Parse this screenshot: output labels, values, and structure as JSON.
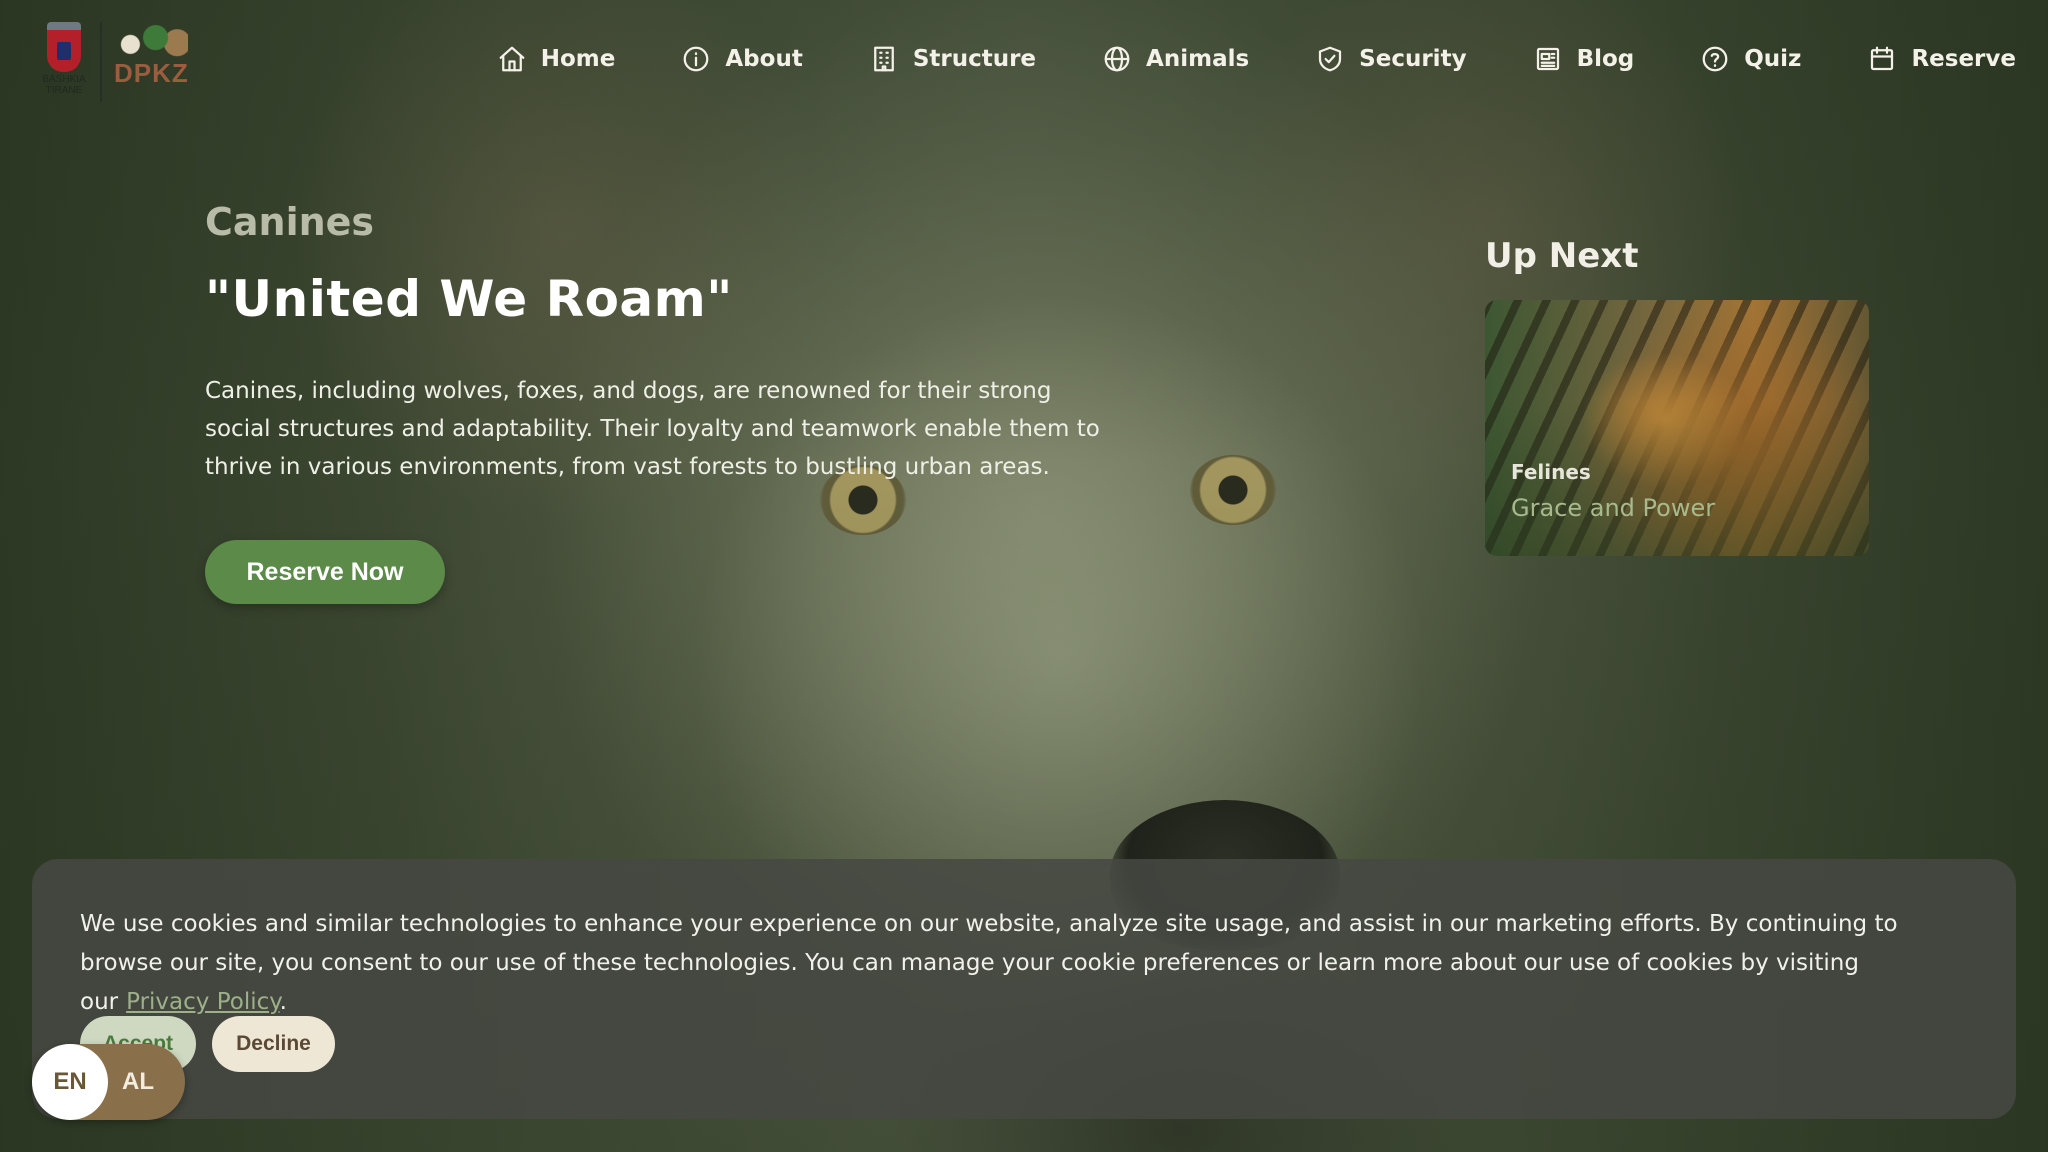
{
  "logo": {
    "city_name": "BASHKIA TIRANE",
    "org_name": "DPKZ"
  },
  "nav": {
    "items": [
      {
        "label": "Home",
        "icon": "home-icon"
      },
      {
        "label": "About",
        "icon": "info-icon"
      },
      {
        "label": "Structure",
        "icon": "building-icon"
      },
      {
        "label": "Animals",
        "icon": "globe-icon"
      },
      {
        "label": "Security",
        "icon": "shield-check-icon"
      },
      {
        "label": "Blog",
        "icon": "newspaper-icon"
      },
      {
        "label": "Quiz",
        "icon": "help-circle-icon"
      },
      {
        "label": "Reserve",
        "icon": "calendar-icon"
      }
    ]
  },
  "hero": {
    "category": "Canines",
    "headline": "\"United We Roam\"",
    "description": "Canines, including wolves, foxes, and dogs, are renowned for their strong social structures and adaptability. Their loyalty and teamwork enable them to thrive in various environments, from vast forests to bustling urban areas.",
    "cta_label": "Reserve Now"
  },
  "up_next": {
    "title": "Up Next",
    "card": {
      "category": "Felines",
      "subtitle": "Grace and Power"
    }
  },
  "cookie_banner": {
    "text": "We use cookies and similar technologies to enhance your experience on our website, analyze site usage, and assist in our marketing efforts. By continuing to browse our site, you consent to our use of these technologies. You can manage your cookie preferences or learn more about our use of cookies by visiting our",
    "link_label": "Privacy Policy",
    "trailing": ".",
    "accept_label": "Accept",
    "decline_label": "Decline"
  },
  "language": {
    "active": "EN",
    "other": "AL"
  },
  "colors": {
    "accent_green": "#5b8a49",
    "link_green": "#9db089",
    "lang_brown": "#8a6f4b"
  }
}
